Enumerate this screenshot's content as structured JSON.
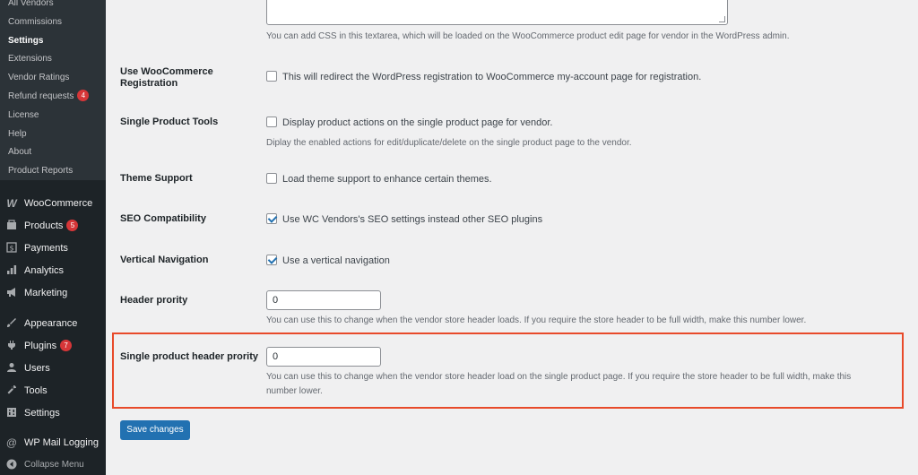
{
  "sidebar": {
    "submenu": [
      {
        "label": "All Vendors"
      },
      {
        "label": "Commissions"
      },
      {
        "label": "Settings",
        "active": true
      },
      {
        "label": "Extensions"
      },
      {
        "label": "Vendor Ratings"
      },
      {
        "label": "Refund requests",
        "badge": "4"
      },
      {
        "label": "License"
      },
      {
        "label": "Help"
      },
      {
        "label": "About"
      },
      {
        "label": "Product Reports"
      }
    ],
    "menu": [
      {
        "label": "WooCommerce",
        "icon": "woo-icon"
      },
      {
        "label": "Products",
        "icon": "products-icon",
        "badge": "5"
      },
      {
        "label": "Payments",
        "icon": "payments-icon"
      },
      {
        "label": "Analytics",
        "icon": "analytics-icon"
      },
      {
        "label": "Marketing",
        "icon": "megaphone-icon"
      },
      {
        "label": "Appearance",
        "icon": "brush-icon"
      },
      {
        "label": "Plugins",
        "icon": "plugin-icon",
        "badge": "7"
      },
      {
        "label": "Users",
        "icon": "user-icon"
      },
      {
        "label": "Tools",
        "icon": "wrench-icon"
      },
      {
        "label": "Settings",
        "icon": "settings-icon"
      },
      {
        "label": "WP Mail Logging",
        "icon": "at-icon"
      },
      {
        "label": "Collapse Menu",
        "icon": "collapse-icon"
      }
    ]
  },
  "main": {
    "css_desc": "You can add CSS in this textarea, which will be loaded on the WooCommerce product edit page for vendor in the WordPress admin.",
    "woo_registration": {
      "label_line1": "Use WooCommerce",
      "label_line2": "Registration",
      "checkbox_text": "This will redirect the WordPress registration to WooCommerce my-account page for registration.",
      "checked": false
    },
    "single_product_tools": {
      "label": "Single Product Tools",
      "checkbox_text": "Display product actions on the single product page for vendor.",
      "desc": "Diplay the enabled actions for edit/duplicate/delete on the single product page to the vendor.",
      "checked": false
    },
    "theme_support": {
      "label": "Theme Support",
      "checkbox_text": "Load theme support to enhance certain themes.",
      "checked": false
    },
    "seo_compat": {
      "label": "SEO Compatibility",
      "checkbox_text": "Use WC Vendors's SEO settings instead other SEO plugins",
      "checked": true
    },
    "vertical_nav": {
      "label": "Vertical Navigation",
      "checkbox_text": "Use a vertical navigation",
      "checked": true
    },
    "header_priority": {
      "label": "Header prority",
      "value": "0",
      "desc": "You can use this to change when the vendor store header loads. If you require the store header to be full width, make this number lower."
    },
    "single_header_priority": {
      "label": "Single product header prority",
      "value": "0",
      "desc_line1": "You can use this to change when the vendor store header load on the single product page. If you require the store header to be full width, make this",
      "desc_line2": "number lower."
    },
    "save_label": "Save changes"
  },
  "colors": {
    "sidebar_bg": "#1d2327",
    "submenu_bg": "#2c3338",
    "accent": "#2271b1",
    "badge": "#d63638",
    "highlight": "#e84a2a",
    "page_bg": "#f0f0f1"
  }
}
